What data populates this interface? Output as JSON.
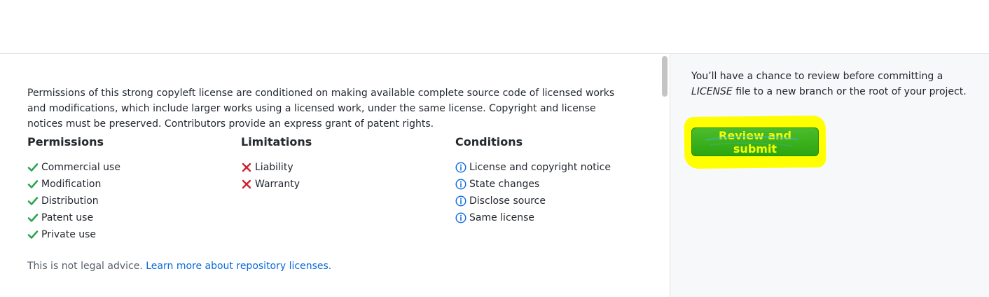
{
  "license_info": {
    "description": "Permissions of this strong copyleft license are conditioned on making available complete source code of licensed works and modifications, which include larger works using a licensed work, under the same license. Copyright and license notices must be preserved. Contributors provide an express grant of patent rights.",
    "permissions": {
      "heading": "Permissions",
      "icon": "check-icon",
      "color": "#2da44e",
      "items": [
        "Commercial use",
        "Modification",
        "Distribution",
        "Patent use",
        "Private use"
      ]
    },
    "limitations": {
      "heading": "Limitations",
      "icon": "x-icon",
      "color": "#cf222e",
      "items": [
        "Liability",
        "Warranty"
      ]
    },
    "conditions": {
      "heading": "Conditions",
      "icon": "info-icon",
      "color": "#0969da",
      "items": [
        "License and copyright notice",
        "State changes",
        "Disclose source",
        "Same license"
      ]
    },
    "footer": {
      "text": "This is not legal advice.",
      "link_text": "Learn more about repository licenses."
    }
  },
  "sidebar": {
    "text_before": "You’ll have a chance to review before committing a ",
    "text_emphasis": "LICENSE",
    "text_after": " file to a new branch or the root of your project.",
    "submit_label": "Review and submit",
    "highlight_color": "#ffff00"
  }
}
